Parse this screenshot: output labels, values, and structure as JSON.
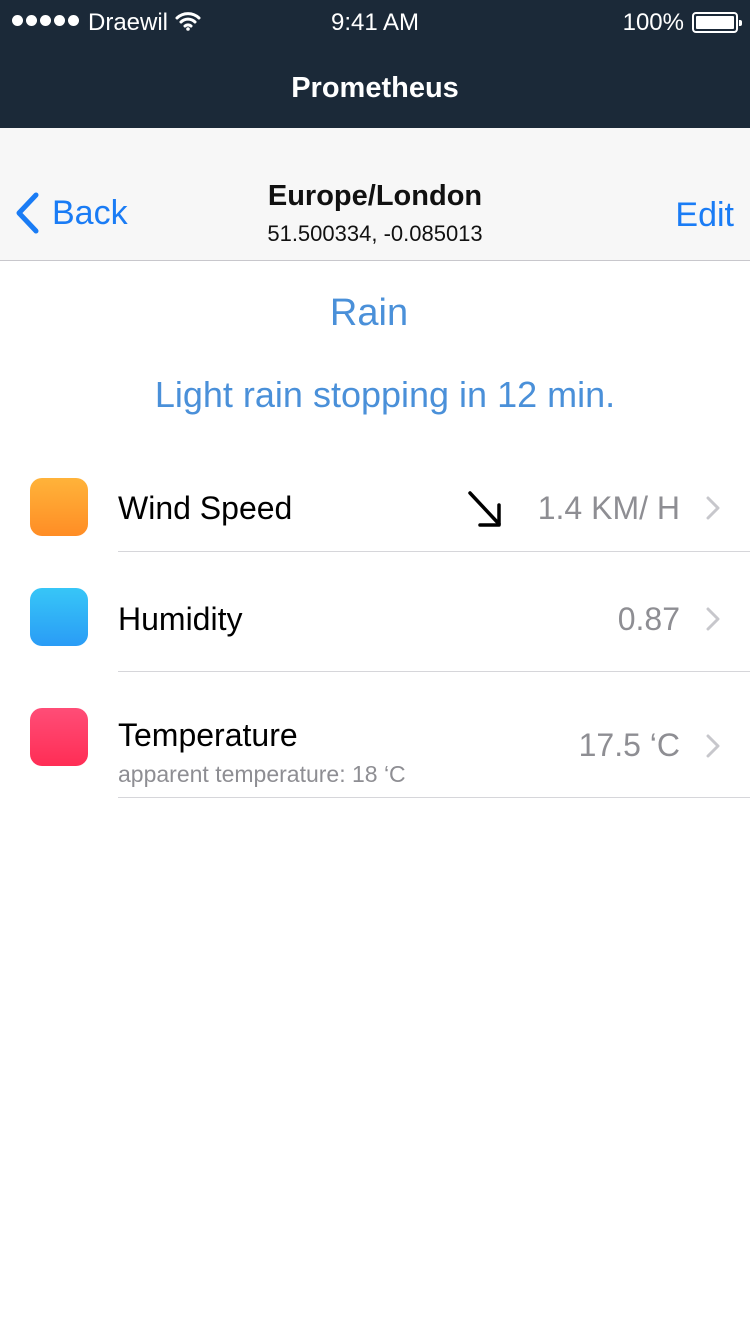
{
  "status_bar": {
    "carrier": "Draewil",
    "time": "9:41 AM",
    "battery_percent": "100%"
  },
  "app": {
    "title": "Prometheus"
  },
  "nav": {
    "back_label": "Back",
    "title": "Europe/London",
    "subtitle": "51.500334, -0.085013",
    "edit_label": "Edit"
  },
  "weather": {
    "summary": "Rain",
    "forecast": "Light rain stopping in 12 min."
  },
  "rows": [
    {
      "label": "Wind Speed",
      "value": "1.4 KM/ H",
      "icon": "wind-direction-arrow-icon",
      "color": "#ff9f2e"
    },
    {
      "label": "Humidity",
      "value": "0.87",
      "color": "#32b5f7"
    },
    {
      "label": "Temperature",
      "sublabel": "apparent temperature: 18 ‘C",
      "value": "17.5 ‘C",
      "color": "#ff3b64"
    }
  ],
  "colors": {
    "header_background": "#1b2938",
    "accent": "#1a7cf5",
    "summary_text": "#4a90d9"
  }
}
